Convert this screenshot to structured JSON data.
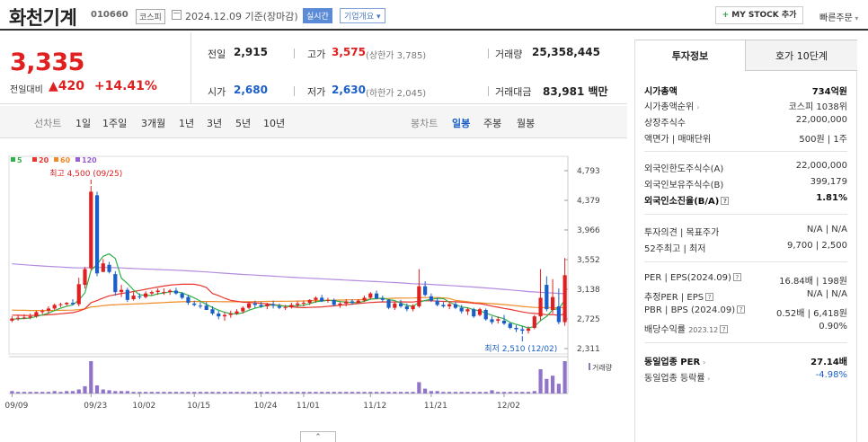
{
  "header": {
    "stock_name": "화천기계",
    "stock_code": "010660",
    "market": "코스피",
    "date_text": "2024.12.09 기준(장마감)",
    "realtime_label": "실시간",
    "company_overview_label": "기업개요",
    "my_stock_label": "MY STOCK 추가",
    "quick_order_label": "빠른주문"
  },
  "price": {
    "current": "3,335",
    "change_label": "전일대비",
    "change_amount": "420",
    "change_pct": "+14.41%",
    "prev_close_label": "전일",
    "prev_close": "2,915",
    "high_label": "고가",
    "high": "3,575",
    "high_sub": "(상한가 3,785)",
    "volume_label": "거래량",
    "volume": "25,358,445",
    "open_label": "시가",
    "open": "2,680",
    "low_label": "저가",
    "low": "2,630",
    "low_sub": "(하한가 2,045)",
    "amount_label": "거래대금",
    "amount": "83,981",
    "amount_unit": "백만"
  },
  "period_tabs": [
    "선차트",
    "1일",
    "1주일",
    "3개월",
    "1년",
    "3년",
    "5년",
    "10년"
  ],
  "candle_tabs": {
    "label": "봉차트",
    "items": [
      "일봉",
      "주봉",
      "월봉"
    ],
    "selected": "일봉"
  },
  "right_panel": {
    "tabs": [
      "투자정보",
      "호가 10단계"
    ],
    "rows": {
      "market_cap_label": "시가총액",
      "market_cap": "734억원",
      "market_cap_rank_label": "시가총액순위",
      "market_cap_rank": "코스피 1038위",
      "shares_label": "상장주식수",
      "shares": "22,000,000",
      "face_value_label": "액면가 | 매매단위",
      "face_value": "500원 | 1주",
      "foreign_limit_label": "외국인한도주식수(A)",
      "foreign_limit": "22,000,000",
      "foreign_hold_label": "외국인보유주식수(B)",
      "foreign_hold": "399,179",
      "foreign_ratio_label": "외국인소진율(B/A)",
      "foreign_ratio": "1.81%",
      "opinion_label": "투자의견 | 목표주가",
      "opinion": "N/A | N/A",
      "week52_label": "52주최고 | 최저",
      "week52": "9,700 | 2,500",
      "per_label": "PER | EPS(2024.09)",
      "per": "16.84배 | 198원",
      "est_per_label": "추정PER | EPS",
      "est_per": "N/A | N/A",
      "pbr_label": "PBR | BPS (2024.09)",
      "pbr": "0.52배 | 6,418원",
      "dividend_label": "배당수익률",
      "dividend_date": "2023.12",
      "dividend": "0.90%",
      "industry_per_label": "동일업종 PER",
      "industry_per": "27.14배",
      "industry_rate_label": "동일업종 등락률",
      "industry_rate": "-4.98%"
    }
  },
  "chart_data": {
    "type": "candlestick",
    "ma_legend": [
      {
        "name": "5",
        "color": "#2fb04a"
      },
      {
        "name": "20",
        "color": "#e8362e"
      },
      {
        "name": "60",
        "color": "#f08a24"
      },
      {
        "name": "120",
        "color": "#9b5dd6"
      }
    ],
    "y_ticks": [
      "4,793",
      "4,379",
      "3,966",
      "3,552",
      "3,138",
      "2,725",
      "2,311"
    ],
    "y_range": [
      2311,
      4793
    ],
    "x_labels": [
      "09/09",
      "09/23",
      "10/02",
      "10/15",
      "10/24",
      "11/01",
      "11/12",
      "11/21",
      "12/02"
    ],
    "max_annotation": "최고 4,500 (09/25)",
    "min_annotation": "최저 2,510 (12/02)",
    "volume_label": "거래량",
    "candles": [
      [
        2700,
        2760,
        2680,
        2730
      ],
      [
        2730,
        2780,
        2700,
        2740
      ],
      [
        2740,
        2790,
        2720,
        2745
      ],
      [
        2745,
        2800,
        2720,
        2760
      ],
      [
        2760,
        2840,
        2740,
        2820
      ],
      [
        2820,
        2860,
        2790,
        2835
      ],
      [
        2840,
        2900,
        2800,
        2870
      ],
      [
        2870,
        2940,
        2850,
        2920
      ],
      [
        2920,
        2950,
        2890,
        2930
      ],
      [
        2930,
        2960,
        2910,
        2950
      ],
      [
        2950,
        3000,
        2920,
        2930
      ],
      [
        2930,
        3300,
        2900,
        3210
      ],
      [
        3200,
        3450,
        3150,
        3420
      ],
      [
        3430,
        4580,
        3400,
        4500
      ],
      [
        4450,
        4500,
        3320,
        3360
      ],
      [
        3380,
        3560,
        3380,
        3500
      ],
      [
        3480,
        3520,
        3360,
        3380
      ],
      [
        3350,
        3390,
        3050,
        3100
      ],
      [
        3100,
        3200,
        3030,
        3130
      ],
      [
        3130,
        3160,
        2960,
        2990
      ],
      [
        3000,
        3100,
        2980,
        3050
      ],
      [
        3040,
        3080,
        3000,
        3030
      ],
      [
        3030,
        3110,
        3010,
        3080
      ],
      [
        3080,
        3120,
        3050,
        3100
      ],
      [
        3100,
        3150,
        3060,
        3120
      ],
      [
        3100,
        3150,
        3060,
        3100
      ],
      [
        3100,
        3140,
        3060,
        3120
      ],
      [
        3120,
        3160,
        3060,
        3080
      ],
      [
        3080,
        3100,
        3000,
        3020
      ],
      [
        3030,
        3060,
        2920,
        2950
      ],
      [
        2940,
        2980,
        2900,
        2920
      ],
      [
        2910,
        2960,
        2870,
        2900
      ],
      [
        2910,
        2960,
        2870,
        2850
      ],
      [
        2860,
        2900,
        2780,
        2800
      ],
      [
        2800,
        2840,
        2720,
        2760
      ],
      [
        2760,
        2820,
        2700,
        2780
      ],
      [
        2780,
        2840,
        2740,
        2800
      ],
      [
        2800,
        2860,
        2780,
        2830
      ],
      [
        2830,
        2900,
        2800,
        2880
      ],
      [
        2880,
        2960,
        2860,
        2940
      ],
      [
        2940,
        2980,
        2880,
        2920
      ],
      [
        2920,
        2960,
        2880,
        2900
      ],
      [
        2900,
        2950,
        2860,
        2930
      ],
      [
        2930,
        2980,
        2870,
        2910
      ],
      [
        2900,
        2940,
        2860,
        2880
      ],
      [
        2890,
        2920,
        2850,
        2890
      ],
      [
        2890,
        2950,
        2870,
        2920
      ],
      [
        2920,
        2970,
        2890,
        2940
      ],
      [
        2940,
        2980,
        2900,
        2950
      ],
      [
        2950,
        3000,
        2920,
        2990
      ],
      [
        2990,
        3040,
        2950,
        3020
      ],
      [
        3020,
        3060,
        2960,
        2970
      ],
      [
        2980,
        3020,
        2950,
        2990
      ],
      [
        2990,
        3010,
        2900,
        2920
      ],
      [
        2920,
        2960,
        2880,
        2940
      ],
      [
        2940,
        3000,
        2900,
        2970
      ],
      [
        2970,
        3000,
        2920,
        2950
      ],
      [
        2950,
        3000,
        2940,
        2980
      ],
      [
        2980,
        3050,
        2960,
        3020
      ],
      [
        3020,
        3100,
        3000,
        3080
      ],
      [
        3080,
        3120,
        3000,
        3010
      ],
      [
        3010,
        3050,
        2960,
        2990
      ],
      [
        2990,
        3000,
        2860,
        2880
      ],
      [
        2880,
        2960,
        2850,
        2940
      ],
      [
        2940,
        2990,
        2880,
        2900
      ],
      [
        2900,
        2940,
        2830,
        2860
      ],
      [
        2860,
        2930,
        2830,
        2910
      ],
      [
        2900,
        3420,
        2880,
        3180
      ],
      [
        3180,
        3250,
        3040,
        3060
      ],
      [
        3040,
        3080,
        2960,
        2980
      ],
      [
        2980,
        3020,
        2900,
        2920
      ],
      [
        2920,
        2960,
        2880,
        2900
      ],
      [
        2900,
        2960,
        2860,
        2930
      ],
      [
        2930,
        2960,
        2860,
        2880
      ],
      [
        2880,
        2920,
        2800,
        2830
      ],
      [
        2830,
        2880,
        2780,
        2860
      ],
      [
        2860,
        2880,
        2740,
        2760
      ],
      [
        2780,
        2880,
        2760,
        2860
      ],
      [
        2850,
        2870,
        2700,
        2720
      ],
      [
        2720,
        2760,
        2650,
        2680
      ],
      [
        2700,
        2760,
        2660,
        2720
      ],
      [
        2700,
        2780,
        2640,
        2660
      ],
      [
        2660,
        2680,
        2580,
        2600
      ],
      [
        2600,
        2640,
        2540,
        2580
      ],
      [
        2580,
        2620,
        2510,
        2560
      ],
      [
        2560,
        2620,
        2520,
        2590
      ],
      [
        2600,
        2780,
        2580,
        2760
      ],
      [
        2760,
        3420,
        2700,
        3020
      ],
      [
        3200,
        3320,
        2830,
        2860
      ],
      [
        2850,
        3280,
        2800,
        3030
      ],
      [
        2900,
        3150,
        2650,
        2680
      ],
      [
        2680,
        3575,
        2630,
        3335
      ]
    ],
    "volumes": [
      3,
      2,
      2,
      2,
      2,
      2,
      2,
      3,
      2,
      3,
      3,
      5,
      9,
      40,
      10,
      5,
      4,
      3,
      3,
      3,
      2,
      2,
      2,
      2,
      2,
      2,
      2,
      2,
      2,
      2,
      2,
      2,
      2,
      2,
      2,
      2,
      2,
      2,
      2,
      2,
      2,
      2,
      2,
      2,
      2,
      2,
      2,
      2,
      2,
      2,
      2,
      2,
      2,
      2,
      2,
      2,
      2,
      2,
      2,
      2,
      2,
      2,
      2,
      2,
      2,
      2,
      2,
      14,
      6,
      3,
      3,
      2,
      2,
      2,
      2,
      2,
      2,
      2,
      2,
      4,
      2,
      2,
      2,
      2,
      2,
      2,
      3,
      30,
      18,
      22,
      12,
      40
    ]
  }
}
